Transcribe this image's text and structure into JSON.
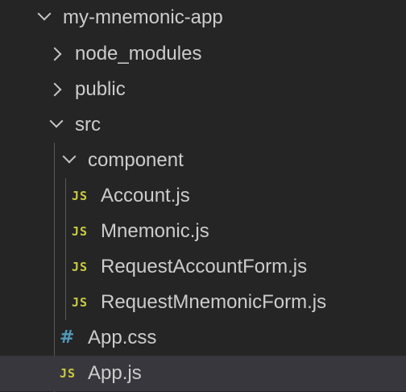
{
  "explorer": {
    "root": {
      "label": "my-mnemonic-app",
      "icon": "chevron-down-icon"
    },
    "items": [
      {
        "label": "node_modules",
        "icon": "chevron-right-icon"
      },
      {
        "label": "public",
        "icon": "chevron-right-icon"
      },
      {
        "label": "src",
        "icon": "chevron-down-icon"
      },
      {
        "label": "component",
        "icon": "chevron-down-icon"
      },
      {
        "label": "Account.js",
        "badge": "JS",
        "icon": "js-file-icon"
      },
      {
        "label": "Mnemonic.js",
        "badge": "JS",
        "icon": "js-file-icon"
      },
      {
        "label": "RequestAccountForm.js",
        "badge": "JS",
        "icon": "js-file-icon"
      },
      {
        "label": "RequestMnemonicForm.js",
        "badge": "JS",
        "icon": "js-file-icon"
      },
      {
        "label": "App.css",
        "badge": "#",
        "icon": "css-file-icon"
      },
      {
        "label": "App.js",
        "badge": "JS",
        "icon": "js-file-icon",
        "selected": true
      }
    ],
    "colors": {
      "background": "#252526",
      "selected_row": "#37373d",
      "text": "#cccccc",
      "js_badge": "#cbcb41",
      "css_badge": "#519aba",
      "indent_guide": "#585858"
    }
  }
}
